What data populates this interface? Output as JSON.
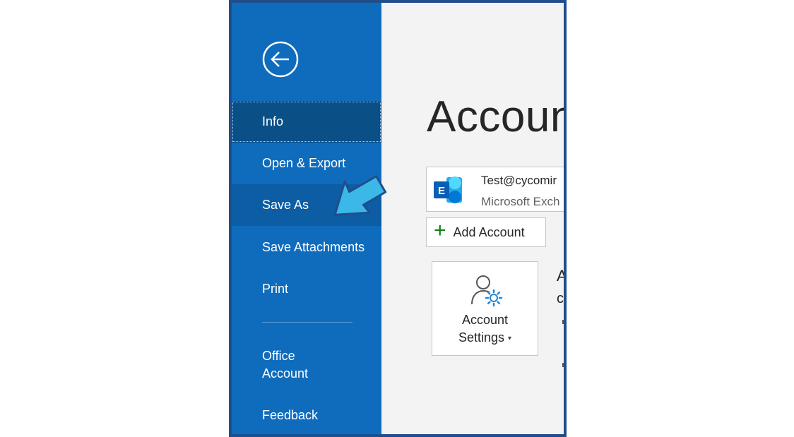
{
  "sidebar": {
    "back_icon": "back-arrow-circle-icon",
    "items": [
      {
        "label": "Info",
        "state": "active"
      },
      {
        "label": "Open & Export",
        "state": "normal"
      },
      {
        "label": "Save As",
        "state": "highlighted"
      },
      {
        "label": "Save Attachments",
        "state": "normal"
      },
      {
        "label": "Print",
        "state": "normal"
      }
    ],
    "bottom_items": [
      {
        "label_line1": "Office",
        "label_line2": "Account"
      },
      {
        "label": "Feedback"
      }
    ],
    "colors": {
      "background": "#0f6cbd",
      "active": "#0b4f87",
      "highlight": "#0c5da3"
    }
  },
  "main": {
    "title": "Accoun",
    "account": {
      "email": "Test@cycomir",
      "type": "Microsoft Exch",
      "icon": "exchange-icon"
    },
    "add_account_label": "Add Account",
    "account_settings": {
      "line1": "Account",
      "line2": "Settings",
      "icon": "account-settings-icon"
    },
    "cut_text_1": "A",
    "cut_text_2": "c"
  },
  "annotation": {
    "arrow_color": "#3bb8e8",
    "arrow_icon": "pointer-arrow-icon"
  }
}
